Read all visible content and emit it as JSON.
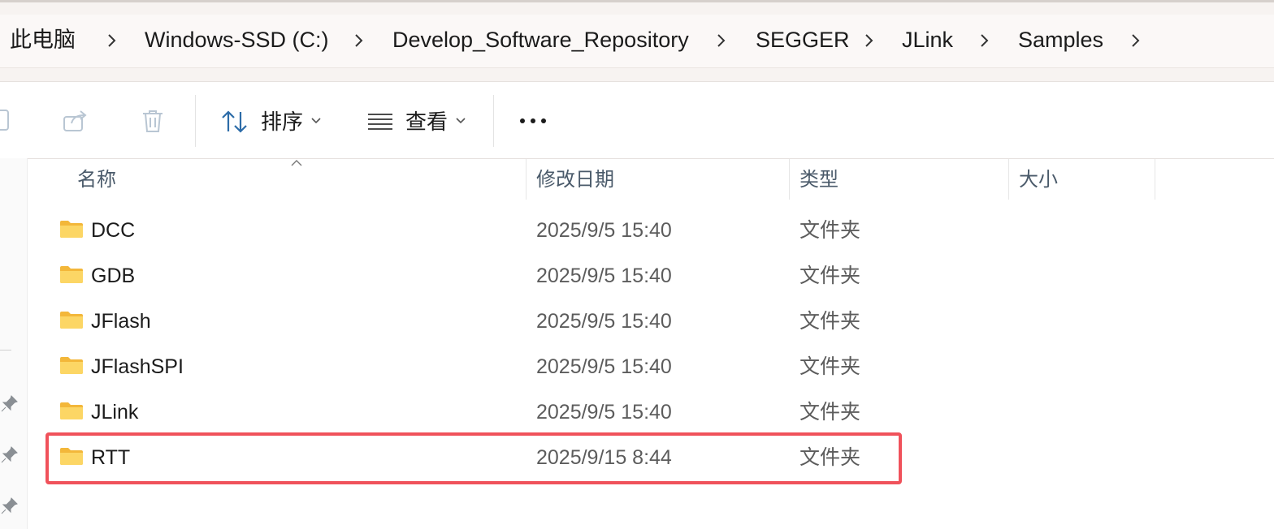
{
  "breadcrumb": {
    "items": [
      "此电脑",
      "Windows-SSD (C:)",
      "Develop_Software_Repository",
      "SEGGER",
      "JLink",
      "Samples"
    ]
  },
  "toolbar": {
    "sort_label": "排序",
    "view_label": "查看",
    "more_label": "•••",
    "icons": [
      "rename-icon",
      "share-icon",
      "delete-icon",
      "sort-icon",
      "view-icon",
      "more-icon"
    ]
  },
  "columns": {
    "name": "名称",
    "modified": "修改日期",
    "type": "类型",
    "size": "大小"
  },
  "files": [
    {
      "name": "DCC",
      "modified": "2025/9/5 15:40",
      "type": "文件夹"
    },
    {
      "name": "GDB",
      "modified": "2025/9/5 15:40",
      "type": "文件夹"
    },
    {
      "name": "JFlash",
      "modified": "2025/9/5 15:40",
      "type": "文件夹"
    },
    {
      "name": "JFlashSPI",
      "modified": "2025/9/5 15:40",
      "type": "文件夹"
    },
    {
      "name": "JLink",
      "modified": "2025/9/5 15:40",
      "type": "文件夹"
    },
    {
      "name": "RTT",
      "modified": "2025/9/15 8:44",
      "type": "文件夹"
    }
  ],
  "colors": {
    "highlight": "#f0525b",
    "folder": "#f7c84b"
  }
}
